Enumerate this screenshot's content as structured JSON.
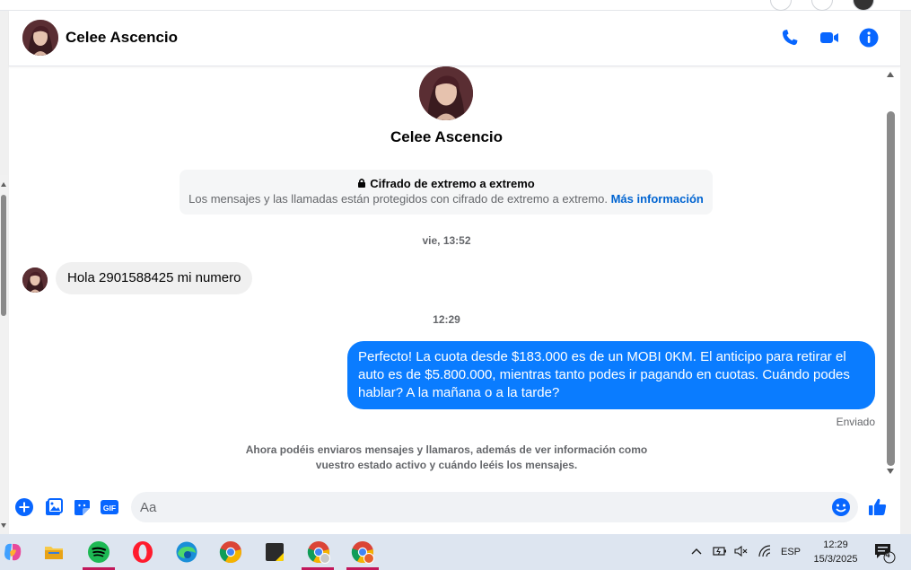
{
  "contact": {
    "name": "Celee Ascencio"
  },
  "header": {
    "icons": [
      "phone-icon",
      "video-icon",
      "info-icon"
    ]
  },
  "encryption": {
    "title": "Cifrado de extremo a extremo",
    "body": "Los mensajes y las llamadas están protegidos con cifrado de extremo a extremo.",
    "link": "Más información"
  },
  "messages": [
    {
      "type": "timestamp",
      "text": "vie, 13:52"
    },
    {
      "type": "incoming",
      "text": "Hola 2901588425 mi numero"
    },
    {
      "type": "timestamp",
      "text": "12:29"
    },
    {
      "type": "outgoing",
      "text": "Perfecto! La cuota desde $183.000 es de un MOBI 0KM. El anticipo para retirar el auto es de $5.800.000, mientras tanto podes ir pagando en cuotas. Cuándo podes hablar? A la mañana o a la tarde?",
      "status": "Enviado"
    }
  ],
  "notice": {
    "line1": "Ahora podéis enviaros mensajes y llamaros, además de ver información como",
    "line2": "vuestro estado activo y cuándo leéis los mensajes."
  },
  "composer": {
    "placeholder": "Aa",
    "gif_label": "GIF",
    "icons": [
      "add-icon",
      "gallery-icon",
      "sticker-icon",
      "gif-icon",
      "emoji-icon",
      "like-icon"
    ]
  },
  "taskbar": {
    "apps": [
      "copilot-icon",
      "file-explorer-icon",
      "spotify-icon",
      "opera-icon",
      "edge-icon",
      "chrome-icon",
      "sticky-notes-icon",
      "chrome-profile-icon",
      "chrome-profile-2-icon"
    ],
    "language": "ESP",
    "time": "12:29",
    "date": "15/3/2025",
    "notification_count": "4"
  },
  "colors": {
    "accent": "#0a7cff",
    "link": "#0064d1",
    "icon_blue": "#0866ff"
  }
}
